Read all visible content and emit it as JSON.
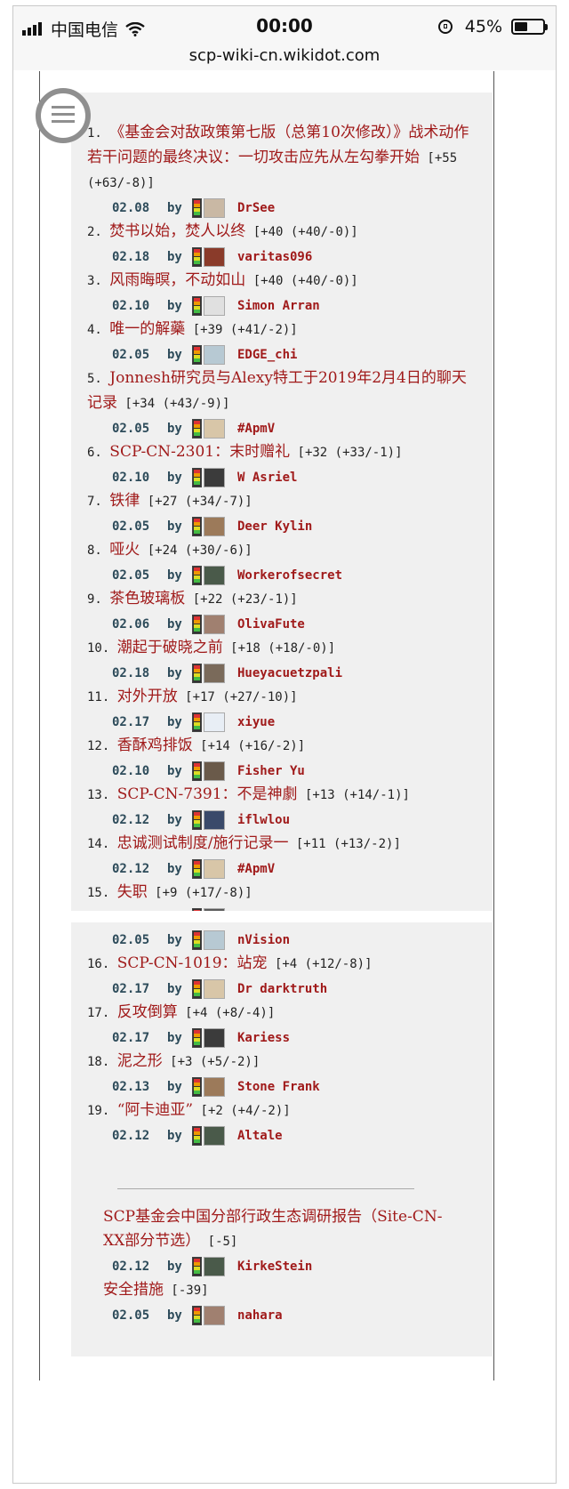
{
  "status_bar": {
    "carrier": "中国电信",
    "time": "00:00",
    "battery": "45%",
    "battery_level": 0.45,
    "url": "scp-wiki-cn.wikidot.com"
  },
  "icons": [
    "signal-icon",
    "wifi-icon",
    "rotation-lock-icon",
    "battery-icon",
    "menu-icon",
    "rating-meter-icon",
    "avatar-icon"
  ],
  "colors": {
    "title": "#a01a1a",
    "date": "#2d4b5a",
    "panel_bg": "#f0f0f0"
  },
  "ranking_top": [
    {
      "num": "1.",
      "title": "《基金会对敌政策第七版（总第10次修改）》战术动作若干问题的最终决议：一切攻击应先从左勾拳开始",
      "score": "[+55 (+63/-8)]",
      "date": "02.08",
      "by": "by",
      "user": "DrSee"
    },
    {
      "num": "2.",
      "title": "焚书以始，焚人以终",
      "score": "[+40 (+40/-0)]",
      "date": "02.18",
      "by": "by",
      "user": "varitas096"
    },
    {
      "num": "3.",
      "title": "风雨晦暝，不动如山",
      "score": "[+40 (+40/-0)]",
      "date": "02.10",
      "by": "by",
      "user": "Simon Arran"
    },
    {
      "num": "4.",
      "title": "唯一的解藥",
      "score": "[+39 (+41/-2)]",
      "date": "02.05",
      "by": "by",
      "user": "EDGE_chi"
    },
    {
      "num": "5.",
      "title": "Jonnesh研究员与Alexy特工于2019年2月4日的聊天记录",
      "score": "[+34 (+43/-9)]",
      "date": "02.05",
      "by": "by",
      "user": "#ApmV"
    },
    {
      "num": "6.",
      "title": "SCP-CN-2301：末时赠礼",
      "score": "[+32 (+33/-1)]",
      "date": "02.10",
      "by": "by",
      "user": "W Asriel"
    },
    {
      "num": "7.",
      "title": "铁律",
      "score": "[+27 (+34/-7)]",
      "date": "02.05",
      "by": "by",
      "user": "Deer Kylin"
    },
    {
      "num": "8.",
      "title": "哑火",
      "score": "[+24 (+30/-6)]",
      "date": "02.05",
      "by": "by",
      "user": "Workerofsecret"
    },
    {
      "num": "9.",
      "title": "茶色玻璃板",
      "score": "[+22 (+23/-1)]",
      "date": "02.06",
      "by": "by",
      "user": "OlivaFute"
    },
    {
      "num": "10.",
      "title": "潮起于破晓之前",
      "score": "[+18 (+18/-0)]",
      "date": "02.18",
      "by": "by",
      "user": "Hueyacuetzpali"
    },
    {
      "num": "11.",
      "title": "对外开放",
      "score": "[+17 (+27/-10)]",
      "date": "02.17",
      "by": "by",
      "user": "xiyue"
    },
    {
      "num": "12.",
      "title": "香酥鸡排饭",
      "score": "[+14 (+16/-2)]",
      "date": "02.10",
      "by": "by",
      "user": "Fisher Yu"
    },
    {
      "num": "13.",
      "title": "SCP-CN-7391：不是神劇",
      "score": "[+13 (+14/-1)]",
      "date": "02.12",
      "by": "by",
      "user": "iflwlou"
    },
    {
      "num": "14.",
      "title": "忠诚测试制度/施行记录一",
      "score": "[+11 (+13/-2)]",
      "date": "02.12",
      "by": "by",
      "user": "#ApmV"
    },
    {
      "num": "15.",
      "title": "失职",
      "score": "[+9 (+17/-8)]",
      "date": "02.05",
      "by": "by",
      "user": "nVision"
    }
  ],
  "ranking_bottom": [
    {
      "num": "15.",
      "title": "失职",
      "score": "[+9 (+17/-8)]",
      "date": "02.05",
      "by": "by",
      "user": "nVision"
    },
    {
      "num": "16.",
      "title": "SCP-CN-1019：站宠",
      "score": "[+4 (+12/-8)]",
      "date": "02.17",
      "by": "by",
      "user": "Dr darktruth"
    },
    {
      "num": "17.",
      "title": "反攻倒算",
      "score": "[+4 (+8/-4)]",
      "date": "02.17",
      "by": "by",
      "user": "Kariess"
    },
    {
      "num": "18.",
      "title": "泥之形",
      "score": "[+3 (+5/-2)]",
      "date": "02.13",
      "by": "by",
      "user": "Stone Frank"
    },
    {
      "num": "19.",
      "title": "“阿卡迪亚”",
      "score": "[+2 (+4/-2)]",
      "date": "02.12",
      "by": "by",
      "user": "Altale"
    }
  ],
  "extra": [
    {
      "title": "SCP基金会中国分部行政生态调研报告（Site-CN-XX部分节选）",
      "score": "[-5]",
      "date": "02.12",
      "by": "by",
      "user": "KirkeStein"
    },
    {
      "title": "安全措施",
      "score": "[-39]",
      "date": "02.05",
      "by": "by",
      "user": "nahara"
    }
  ]
}
